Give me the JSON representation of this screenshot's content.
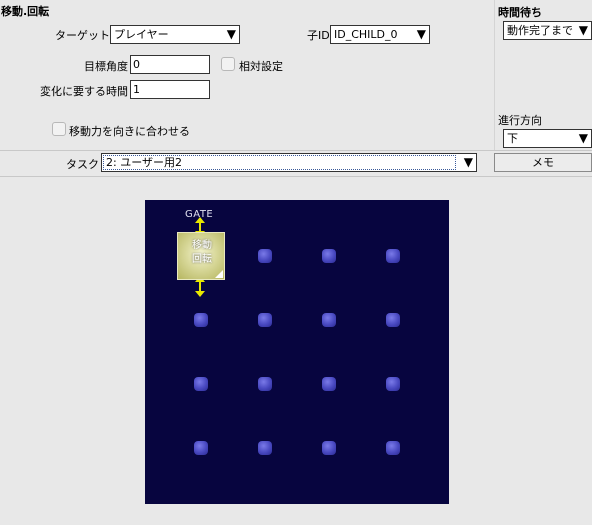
{
  "panel": {
    "title": "移動.回転",
    "target_label": "ターゲット",
    "target_value": "プレイヤー",
    "child_label": "子ID",
    "child_value": "ID_CHILD_0",
    "angle_label": "目標角度",
    "angle_value": "0",
    "relative_label": "相対設定",
    "relative_checked": false,
    "time_label": "変化に要する時間",
    "time_value": "1",
    "align_label": "移動力を向きに合わせる",
    "align_checked": false
  },
  "side": {
    "wait_label": "時間待ち",
    "wait_value": "動作完了まで",
    "direction_label": "進行方向",
    "direction_value": "下"
  },
  "task": {
    "label": "タスク",
    "value": "2: ユーザー用2",
    "memo_label": "メモ"
  },
  "map": {
    "gate_label": "GATE",
    "active_node_line1": "移動",
    "active_node_line2": "回転",
    "colors": {
      "background": "#07053f",
      "node": "#4848c0",
      "active": "#d8d89a",
      "connector": "#e8e800"
    }
  }
}
